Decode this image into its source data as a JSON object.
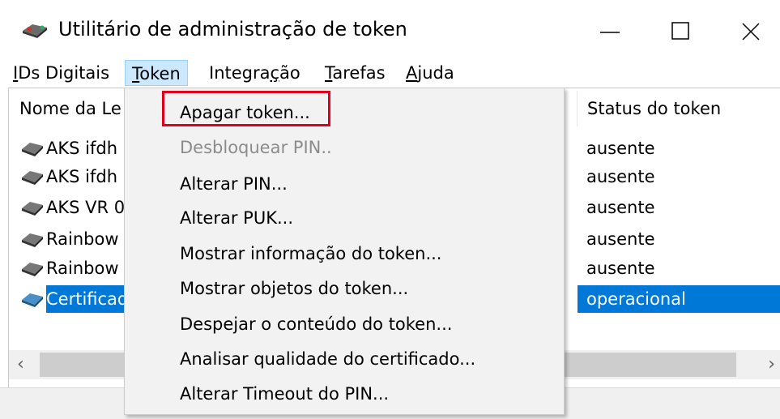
{
  "window": {
    "title": "Utilitário de administração de token",
    "controls": {
      "minimize": "—",
      "maximize": "☐",
      "close": "✕"
    }
  },
  "menubar": {
    "items": [
      {
        "label_u": "I",
        "label_rest": "Ds Digitais"
      },
      {
        "label_u": "T",
        "label_rest": "oken"
      },
      {
        "label_pre": "Integra",
        "label_u": "ç",
        "label_rest": "ão"
      },
      {
        "label_u": "T",
        "label_rest": "arefas"
      },
      {
        "label_u": "A",
        "label_rest": "juda"
      }
    ]
  },
  "list": {
    "columns": {
      "name": "Nome da Le",
      "status": "Status do token"
    },
    "rows": [
      {
        "name": "AKS ifdh",
        "status": "ausente",
        "icon": "token-reader-icon"
      },
      {
        "name": "AKS ifdh",
        "status": "ausente",
        "icon": "token-reader-icon"
      },
      {
        "name": "AKS VR 0",
        "status": "ausente",
        "icon": "token-reader-icon"
      },
      {
        "name": "Rainbow",
        "status": "ausente",
        "icon": "token-reader-icon"
      },
      {
        "name": "Rainbow",
        "status": "ausente",
        "icon": "token-reader-icon"
      },
      {
        "name": "Certificad",
        "status": "operacional",
        "icon": "token-reader-active-icon",
        "selected": true
      }
    ],
    "scroll_left": "‹",
    "scroll_right": "›"
  },
  "token_menu": {
    "items": [
      {
        "label": "Apagar token...",
        "enabled": true
      },
      {
        "label": "Desbloquear PIN..",
        "enabled": false
      },
      {
        "label": "Alterar PIN...",
        "enabled": true
      },
      {
        "label": "Alterar PUK...",
        "enabled": true
      },
      {
        "label": "Mostrar informação do token...",
        "enabled": true
      },
      {
        "label": "Mostrar objetos do token...",
        "enabled": true
      },
      {
        "label": "Despejar o conteúdo do token...",
        "enabled": true
      },
      {
        "label": "Analisar qualidade do certificado...",
        "enabled": true
      },
      {
        "label": "Alterar Timeout do PIN...",
        "enabled": true
      }
    ]
  },
  "colors": {
    "selection": "#0078d7",
    "highlight_box": "#e0001b",
    "menu_bg": "#f2f2f2"
  }
}
